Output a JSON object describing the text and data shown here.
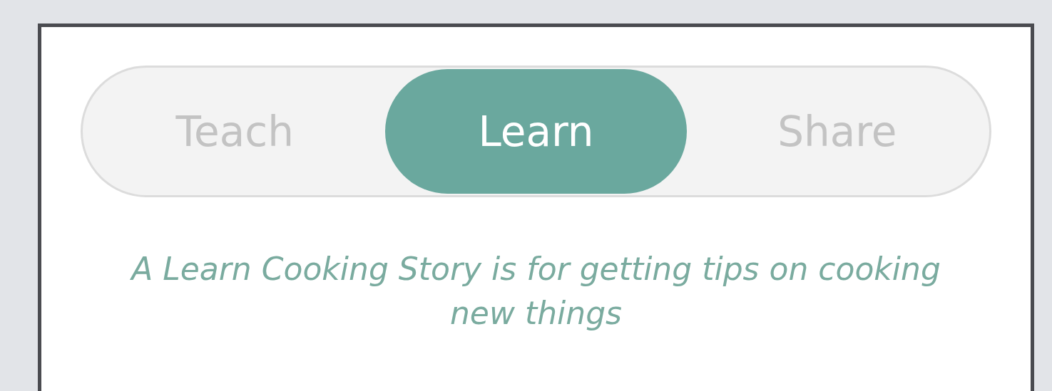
{
  "tabs": [
    {
      "label": "Teach",
      "selected": false
    },
    {
      "label": "Learn",
      "selected": true
    },
    {
      "label": "Share",
      "selected": false
    }
  ],
  "description": "A Learn Cooking Story is for getting tips on cooking new things"
}
